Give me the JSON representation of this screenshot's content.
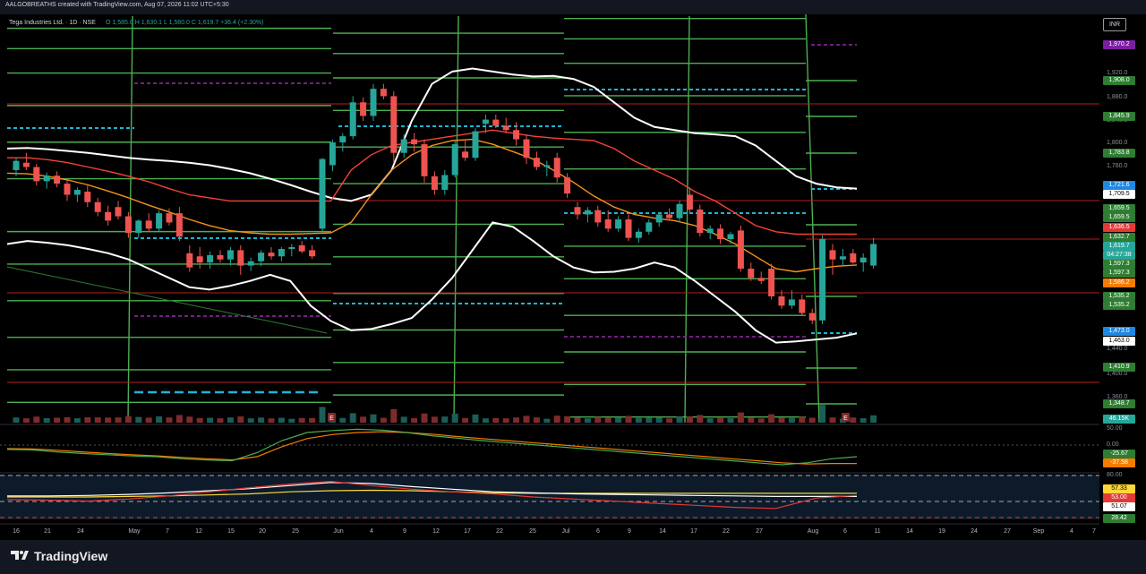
{
  "header": {
    "credit": "AALGOBREATHS created with TradingView.com, Aug 07, 2026 11:02 UTC+5:30",
    "symbol_title": "Tega Industries Ltd. · 1D · NSE",
    "ohlc": "O 1,585.0  H 1,630.1  L 1,580.0  C 1,619.7 +36.4 (+2.30%)",
    "currency_button": "INR"
  },
  "footer": {
    "brand": "TradingView"
  },
  "colors": {
    "up": "#26a69a",
    "down": "#ef5350",
    "green_channel": "#4caf50",
    "bb_line": "#ffffff",
    "sma": "#f7931a",
    "resistance": "#f44336",
    "cyan_dash": "#1fb4d2",
    "purple_dash": "#9c27b0"
  },
  "y_axis_ticks": [
    "1,920.0",
    "1,880.0",
    "1,840.0",
    "1,800.0",
    "1,760.0",
    "1,440.0",
    "1,400.0",
    "1,360.0",
    "50.00",
    "0.00",
    "80.00"
  ],
  "price_badges": [
    {
      "text": "1,970.2",
      "bg": "#7b1fa2",
      "fg": "#ffffff",
      "y": 50
    },
    {
      "text": "1,908.0",
      "bg": "#2e7d32",
      "fg": "#ffffff",
      "y": 90
    },
    {
      "text": "1,845.9",
      "bg": "#2e7d32",
      "fg": "#ffffff",
      "y": 130
    },
    {
      "text": "1,783.8",
      "bg": "#2e7d32",
      "fg": "#ffffff",
      "y": 171
    },
    {
      "text": "1,721.6",
      "bg": "#1e88e5",
      "fg": "#ffffff",
      "y": 207
    },
    {
      "text": "1,709.5",
      "bg": "#ffffff",
      "fg": "#000000",
      "y": 217
    },
    {
      "text": "1,659.5",
      "bg": "#2e7d32",
      "fg": "#ffffff",
      "y": 233
    },
    {
      "text": "1,659.5",
      "bg": "#2e7d32",
      "fg": "#ffffff",
      "y": 243
    },
    {
      "text": "1,636.5",
      "bg": "#e53935",
      "fg": "#ffffff",
      "y": 254
    },
    {
      "text": "1,632.7",
      "bg": "#2e7d32",
      "fg": "#ffffff",
      "y": 265
    },
    {
      "text": "1,619.7",
      "bg": "#26a69a",
      "fg": "#ffffff",
      "y": 275
    },
    {
      "text": "04:27:38",
      "bg": "#26a69a",
      "fg": "#ffffff",
      "y": 285
    },
    {
      "text": "1,597.3",
      "bg": "#2e7d32",
      "fg": "#ffffff",
      "y": 295
    },
    {
      "text": "1,597.3",
      "bg": "#2e7d32",
      "fg": "#ffffff",
      "y": 305
    },
    {
      "text": "1,586.2",
      "bg": "#f57c00",
      "fg": "#ffffff",
      "y": 316
    },
    {
      "text": "1,535.2",
      "bg": "#2e7d32",
      "fg": "#ffffff",
      "y": 331
    },
    {
      "text": "1,535.2",
      "bg": "#2e7d32",
      "fg": "#ffffff",
      "y": 341
    },
    {
      "text": "1,473.0",
      "bg": "#1e88e5",
      "fg": "#ffffff",
      "y": 370
    },
    {
      "text": "1,463.0",
      "bg": "#ffffff",
      "fg": "#000000",
      "y": 381
    },
    {
      "text": "1,410.9",
      "bg": "#2e7d32",
      "fg": "#ffffff",
      "y": 410
    },
    {
      "text": "1,348.7",
      "bg": "#2e7d32",
      "fg": "#ffffff",
      "y": 451
    },
    {
      "text": "46.15K",
      "bg": "#26a69a",
      "fg": "#ffffff",
      "y": 468
    },
    {
      "text": "-25.67",
      "bg": "#2e7d32",
      "fg": "#ffffff",
      "y": 507
    },
    {
      "text": "-37.58",
      "bg": "#f57c00",
      "fg": "#ffffff",
      "y": 517
    },
    {
      "text": "57.33",
      "bg": "#fdd835",
      "fg": "#000000",
      "y": 546
    },
    {
      "text": "53.00",
      "bg": "#e53935",
      "fg": "#ffffff",
      "y": 556
    },
    {
      "text": "51.07",
      "bg": "#ffffff",
      "fg": "#000000",
      "y": 566
    },
    {
      "text": "28.42",
      "bg": "#2e7d32",
      "fg": "#ffffff",
      "y": 579
    }
  ],
  "x_axis_labels": [
    "16",
    "21",
    "24",
    "May",
    "7",
    "12",
    "15",
    "20",
    "25",
    "Jun",
    "4",
    "9",
    "12",
    "17",
    "22",
    "25",
    "Jul",
    "6",
    "9",
    "14",
    "17",
    "22",
    "27",
    "Aug",
    "6",
    "11",
    "14",
    "19",
    "24",
    "27",
    "Sep",
    "4",
    "7"
  ],
  "event_markers": [
    "E",
    "E"
  ],
  "chart_data": {
    "type": "candlestick",
    "y_range": [
      1330,
      1990
    ],
    "candles": [
      {
        "o": 1740,
        "h": 1760,
        "l": 1730,
        "c": 1755
      },
      {
        "o": 1752,
        "h": 1768,
        "l": 1740,
        "c": 1745
      },
      {
        "o": 1745,
        "h": 1750,
        "l": 1715,
        "c": 1722
      },
      {
        "o": 1722,
        "h": 1736,
        "l": 1710,
        "c": 1731
      },
      {
        "o": 1731,
        "h": 1738,
        "l": 1712,
        "c": 1718
      },
      {
        "o": 1718,
        "h": 1725,
        "l": 1690,
        "c": 1700
      },
      {
        "o": 1700,
        "h": 1712,
        "l": 1688,
        "c": 1708
      },
      {
        "o": 1705,
        "h": 1715,
        "l": 1680,
        "c": 1688
      },
      {
        "o": 1688,
        "h": 1695,
        "l": 1665,
        "c": 1672
      },
      {
        "o": 1672,
        "h": 1682,
        "l": 1650,
        "c": 1658
      },
      {
        "o": 1680,
        "h": 1690,
        "l": 1660,
        "c": 1665
      },
      {
        "o": 1665,
        "h": 1672,
        "l": 1630,
        "c": 1638
      },
      {
        "o": 1638,
        "h": 1660,
        "l": 1630,
        "c": 1658
      },
      {
        "o": 1658,
        "h": 1670,
        "l": 1640,
        "c": 1645
      },
      {
        "o": 1645,
        "h": 1675,
        "l": 1640,
        "c": 1670
      },
      {
        "o": 1670,
        "h": 1678,
        "l": 1650,
        "c": 1655
      },
      {
        "o": 1670,
        "h": 1680,
        "l": 1625,
        "c": 1632
      },
      {
        "o": 1605,
        "h": 1618,
        "l": 1575,
        "c": 1582
      },
      {
        "o": 1600,
        "h": 1615,
        "l": 1580,
        "c": 1590
      },
      {
        "o": 1590,
        "h": 1608,
        "l": 1580,
        "c": 1602
      },
      {
        "o": 1602,
        "h": 1610,
        "l": 1590,
        "c": 1595
      },
      {
        "o": 1595,
        "h": 1615,
        "l": 1585,
        "c": 1610
      },
      {
        "o": 1610,
        "h": 1618,
        "l": 1570,
        "c": 1585
      },
      {
        "o": 1585,
        "h": 1598,
        "l": 1576,
        "c": 1592
      },
      {
        "o": 1592,
        "h": 1610,
        "l": 1584,
        "c": 1606
      },
      {
        "o": 1606,
        "h": 1615,
        "l": 1595,
        "c": 1600
      },
      {
        "o": 1600,
        "h": 1615,
        "l": 1592,
        "c": 1612
      },
      {
        "o": 1612,
        "h": 1620,
        "l": 1600,
        "c": 1615
      },
      {
        "o": 1618,
        "h": 1625,
        "l": 1605,
        "c": 1608
      },
      {
        "o": 1610,
        "h": 1618,
        "l": 1596,
        "c": 1600
      },
      {
        "o": 1645,
        "h": 1760,
        "l": 1640,
        "c": 1758
      },
      {
        "o": 1748,
        "h": 1790,
        "l": 1738,
        "c": 1785
      },
      {
        "o": 1785,
        "h": 1800,
        "l": 1770,
        "c": 1795
      },
      {
        "o": 1795,
        "h": 1860,
        "l": 1790,
        "c": 1850
      },
      {
        "o": 1850,
        "h": 1858,
        "l": 1820,
        "c": 1828
      },
      {
        "o": 1828,
        "h": 1880,
        "l": 1820,
        "c": 1872
      },
      {
        "o": 1872,
        "h": 1880,
        "l": 1855,
        "c": 1860
      },
      {
        "o": 1860,
        "h": 1868,
        "l": 1752,
        "c": 1768
      },
      {
        "o": 1768,
        "h": 1798,
        "l": 1760,
        "c": 1790
      },
      {
        "o": 1790,
        "h": 1800,
        "l": 1770,
        "c": 1782
      },
      {
        "o": 1782,
        "h": 1790,
        "l": 1720,
        "c": 1730
      },
      {
        "o": 1730,
        "h": 1738,
        "l": 1700,
        "c": 1708
      },
      {
        "o": 1708,
        "h": 1740,
        "l": 1700,
        "c": 1732
      },
      {
        "o": 1732,
        "h": 1790,
        "l": 1728,
        "c": 1782
      },
      {
        "o": 1770,
        "h": 1790,
        "l": 1755,
        "c": 1760
      },
      {
        "o": 1760,
        "h": 1808,
        "l": 1755,
        "c": 1803
      },
      {
        "o": 1815,
        "h": 1830,
        "l": 1800,
        "c": 1822
      },
      {
        "o": 1822,
        "h": 1830,
        "l": 1808,
        "c": 1812
      },
      {
        "o": 1812,
        "h": 1825,
        "l": 1800,
        "c": 1805
      },
      {
        "o": 1805,
        "h": 1818,
        "l": 1780,
        "c": 1790
      },
      {
        "o": 1790,
        "h": 1798,
        "l": 1750,
        "c": 1760
      },
      {
        "o": 1760,
        "h": 1770,
        "l": 1740,
        "c": 1745
      },
      {
        "o": 1745,
        "h": 1755,
        "l": 1730,
        "c": 1748
      },
      {
        "o": 1760,
        "h": 1768,
        "l": 1720,
        "c": 1728
      },
      {
        "o": 1728,
        "h": 1735,
        "l": 1695,
        "c": 1702
      },
      {
        "o": 1680,
        "h": 1688,
        "l": 1660,
        "c": 1668
      },
      {
        "o": 1668,
        "h": 1680,
        "l": 1655,
        "c": 1675
      },
      {
        "o": 1675,
        "h": 1682,
        "l": 1648,
        "c": 1655
      },
      {
        "o": 1660,
        "h": 1675,
        "l": 1640,
        "c": 1645
      },
      {
        "o": 1645,
        "h": 1665,
        "l": 1640,
        "c": 1660
      },
      {
        "o": 1660,
        "h": 1668,
        "l": 1625,
        "c": 1630
      },
      {
        "o": 1630,
        "h": 1645,
        "l": 1622,
        "c": 1640
      },
      {
        "o": 1640,
        "h": 1660,
        "l": 1635,
        "c": 1655
      },
      {
        "o": 1655,
        "h": 1672,
        "l": 1648,
        "c": 1668
      },
      {
        "o": 1668,
        "h": 1678,
        "l": 1658,
        "c": 1662
      },
      {
        "o": 1662,
        "h": 1690,
        "l": 1655,
        "c": 1685
      },
      {
        "o": 1700,
        "h": 1712,
        "l": 1670,
        "c": 1676
      },
      {
        "o": 1676,
        "h": 1684,
        "l": 1632,
        "c": 1638
      },
      {
        "o": 1638,
        "h": 1650,
        "l": 1628,
        "c": 1645
      },
      {
        "o": 1645,
        "h": 1652,
        "l": 1620,
        "c": 1628
      },
      {
        "o": 1628,
        "h": 1640,
        "l": 1620,
        "c": 1636
      },
      {
        "o": 1642,
        "h": 1650,
        "l": 1575,
        "c": 1580
      },
      {
        "o": 1580,
        "h": 1590,
        "l": 1560,
        "c": 1565
      },
      {
        "o": 1565,
        "h": 1575,
        "l": 1555,
        "c": 1560
      },
      {
        "o": 1580,
        "h": 1588,
        "l": 1530,
        "c": 1535
      },
      {
        "o": 1535,
        "h": 1545,
        "l": 1515,
        "c": 1520
      },
      {
        "o": 1520,
        "h": 1545,
        "l": 1515,
        "c": 1530
      },
      {
        "o": 1530,
        "h": 1538,
        "l": 1505,
        "c": 1508
      },
      {
        "o": 1508,
        "h": 1515,
        "l": 1490,
        "c": 1496
      },
      {
        "o": 1496,
        "h": 1635,
        "l": 1490,
        "c": 1628
      },
      {
        "o": 1610,
        "h": 1620,
        "l": 1570,
        "c": 1595
      },
      {
        "o": 1595,
        "h": 1612,
        "l": 1585,
        "c": 1600
      },
      {
        "o": 1605,
        "h": 1612,
        "l": 1588,
        "c": 1590
      },
      {
        "o": 1590,
        "h": 1605,
        "l": 1575,
        "c": 1598
      },
      {
        "o": 1585,
        "h": 1630,
        "l": 1580,
        "c": 1620
      }
    ],
    "series": [
      {
        "name": "Upper band",
        "values": [
          1775,
          1776,
          1774,
          1771,
          1768,
          1764,
          1760,
          1757,
          1755,
          1752,
          1748,
          1742,
          1735,
          1726,
          1716,
          1705,
          1695,
          1690,
          1700,
          1740,
          1820,
          1880,
          1900,
          1905,
          1900,
          1895,
          1892,
          1893,
          1888,
          1875,
          1850,
          1825,
          1810,
          1805,
          1800,
          1798,
          1795,
          1780,
          1755,
          1730,
          1718,
          1712,
          1710
        ]
      },
      {
        "name": "Lower band",
        "values": [
          1620,
          1625,
          1622,
          1618,
          1612,
          1605,
          1595,
          1580,
          1565,
          1550,
          1546,
          1552,
          1560,
          1570,
          1560,
          1520,
          1495,
          1480,
          1482,
          1490,
          1500,
          1530,
          1565,
          1610,
          1655,
          1648,
          1625,
          1600,
          1582,
          1574,
          1575,
          1580,
          1590,
          1582,
          1560,
          1535,
          1510,
          1480,
          1460,
          1462,
          1465,
          1468,
          1475
        ]
      },
      {
        "name": "SMA",
        "values": [
          1735,
          1734,
          1730,
          1724,
          1716,
          1706,
          1695,
          1683,
          1672,
          1660,
          1650,
          1642,
          1638,
          1636,
          1636,
          1637,
          1638,
          1655,
          1700,
          1740,
          1765,
          1780,
          1788,
          1790,
          1782,
          1770,
          1758,
          1740,
          1720,
          1698,
          1680,
          1668,
          1662,
          1658,
          1650,
          1636,
          1620,
          1600,
          1580,
          1575,
          1580,
          1584,
          1586
        ]
      },
      {
        "name": "Red line",
        "values": [
          1760,
          1760,
          1757,
          1752,
          1745,
          1738,
          1730,
          1721,
          1710,
          1700,
          1695,
          1690,
          1690,
          1690,
          1690,
          1690,
          1690,
          1740,
          1765,
          1780,
          1785,
          1790,
          1795,
          1800,
          1805,
          1800,
          1795,
          1792,
          1790,
          1788,
          1775,
          1755,
          1740,
          1725,
          1705,
          1690,
          1670,
          1650,
          1640,
          1636,
          1636,
          1636,
          1636
        ]
      }
    ],
    "oscillator": {
      "name": "MACD",
      "green": [
        -2,
        -3,
        -8,
        -12,
        -15,
        -18,
        -20,
        -25,
        -28,
        -30,
        -10,
        20,
        40,
        45,
        48,
        46,
        40,
        32,
        26,
        20,
        15,
        10,
        5,
        0,
        -5,
        -10,
        -15,
        -20,
        -25,
        -30,
        -35,
        -40,
        -35,
        -25,
        -20
      ],
      "orange": [
        0,
        -1,
        -4,
        -8,
        -12,
        -15,
        -18,
        -22,
        -25,
        -28,
        -20,
        5,
        25,
        35,
        40,
        42,
        40,
        36,
        30,
        25,
        20,
        15,
        10,
        5,
        0,
        -5,
        -10,
        -15,
        -20,
        -25,
        -30,
        -35,
        -38,
        -37,
        -37
      ]
    },
    "rsi": {
      "white": [
        52,
        52,
        53,
        55,
        58,
        62,
        66,
        72,
        78,
        76,
        70,
        65,
        60,
        58,
        56,
        55,
        54,
        53,
        52,
        51,
        51,
        51
      ],
      "yellow": [
        50,
        50,
        50,
        51,
        52,
        54,
        56,
        60,
        62,
        63,
        62,
        60,
        58,
        57,
        57,
        57,
        57,
        57,
        57,
        57,
        57,
        57
      ],
      "red": [
        45,
        44,
        42,
        46,
        52,
        60,
        68,
        75,
        80,
        72,
        65,
        60,
        56,
        50,
        46,
        42,
        38,
        34,
        30,
        28,
        48,
        53
      ]
    }
  }
}
